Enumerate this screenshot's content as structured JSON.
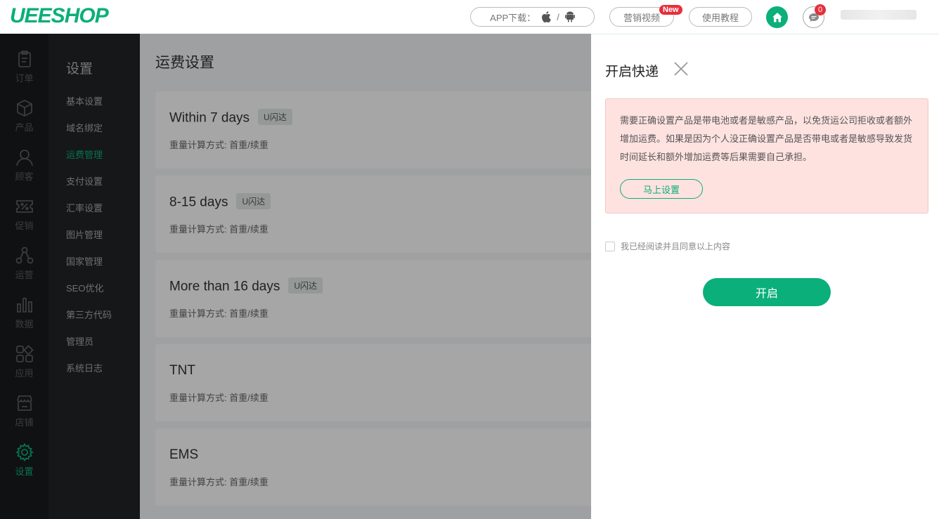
{
  "header": {
    "logo": "UEESHOP",
    "app_download": "APP下载：",
    "slash": "/",
    "marketing_video": "营销视频",
    "new_badge": "New",
    "tutorial": "使用教程",
    "msg_count": "0"
  },
  "nav": [
    {
      "label": "订单",
      "icon": "clipboard-icon"
    },
    {
      "label": "产品",
      "icon": "box-icon"
    },
    {
      "label": "顾客",
      "icon": "user-icon"
    },
    {
      "label": "促销",
      "icon": "percent-ticket-icon"
    },
    {
      "label": "运营",
      "icon": "network-icon"
    },
    {
      "label": "数据",
      "icon": "bar-chart-icon"
    },
    {
      "label": "应用",
      "icon": "apps-icon"
    },
    {
      "label": "店铺",
      "icon": "store-icon"
    },
    {
      "label": "设置",
      "icon": "gear-icon",
      "active": true
    }
  ],
  "settings": {
    "title": "设置",
    "items": [
      "基本设置",
      "域名绑定",
      "运费管理",
      "支付设置",
      "汇率设置",
      "图片管理",
      "国家管理",
      "SEO优化",
      "第三方代码",
      "管理员",
      "系统日志"
    ],
    "active_index": 2
  },
  "main": {
    "title": "运费设置",
    "cards": [
      {
        "name": "Within 7 days",
        "tag": "U闪达",
        "sub": "重量计算方式: 首重/续重"
      },
      {
        "name": "8-15 days",
        "tag": "U闪达",
        "sub": "重量计算方式: 首重/续重"
      },
      {
        "name": "More than 16 days",
        "tag": "U闪达",
        "sub": "重量计算方式: 首重/续重"
      },
      {
        "name": "TNT",
        "tag": "",
        "sub": "重量计算方式: 首重/续重"
      },
      {
        "name": "EMS",
        "tag": "",
        "sub": "重量计算方式: 首重/续重"
      }
    ]
  },
  "drawer": {
    "title": "开启快递",
    "alert_text": "需要正确设置产品是带电池或者是敏感产品，以免货运公司拒收或者额外增加运费。如果是因为个人没正确设置产品是否带电或者是敏感导致发货时间延长和额外增加运费等后果需要自己承担。",
    "alert_button": "马上设置",
    "agree_text": "我已经阅读并且同意以上内容",
    "enable_button": "开启"
  },
  "colors": {
    "accent": "#0baf7a",
    "badge": "#e5303a",
    "alert_bg": "#fde2e0"
  }
}
